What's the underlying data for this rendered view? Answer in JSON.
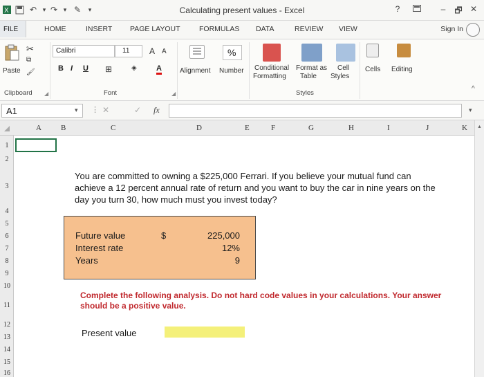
{
  "window": {
    "title": "Calculating present values - Excel",
    "help": "?",
    "minimize": "–",
    "restore": "🗗",
    "close": "✕"
  },
  "quick_access": [
    "save-icon",
    "undo-icon",
    "redo-icon",
    "customize-icon"
  ],
  "tabs": {
    "file": "FILE",
    "items": [
      "HOME",
      "INSERT",
      "PAGE LAYOUT",
      "FORMULAS",
      "DATA",
      "REVIEW",
      "VIEW"
    ],
    "sign_in": "Sign In"
  },
  "ribbon": {
    "clipboard": {
      "paste": "Paste",
      "label": "Clipboard"
    },
    "font": {
      "name": "Calibri",
      "size": "11",
      "grow": "A",
      "shrink": "A",
      "bold": "B",
      "italic": "I",
      "underline": "U",
      "font_color": "A",
      "label": "Font"
    },
    "alignment": "Alignment",
    "number": {
      "symbol": "%",
      "label": "Number"
    },
    "styles": {
      "conditional": "Conditional",
      "conditional2": "Formatting",
      "format_as": "Format as",
      "format_as2": "Table",
      "cell": "Cell",
      "cell2": "Styles",
      "label": "Styles"
    },
    "cells": "Cells",
    "editing": "Editing"
  },
  "formula_bar": {
    "name_box": "A1",
    "fx": "fx",
    "cancel": "✕",
    "enter": "✓",
    "value": ""
  },
  "sheet": {
    "columns": [
      "A",
      "B",
      "C",
      "D",
      "E",
      "F",
      "G",
      "H",
      "I",
      "J",
      "K"
    ],
    "rows": [
      "1",
      "2",
      "3",
      "4",
      "5",
      "6",
      "7",
      "8",
      "9",
      "10",
      "11",
      "12",
      "13",
      "14",
      "15",
      "16"
    ],
    "problem_text": "You are committed to owning a $225,000 Ferrari. If you believe your mutual fund can achieve a 12 percent annual rate of return and you want to buy the car in nine years on the day you turn 30, how much must you invest today?",
    "inputs": [
      {
        "label": "Future value",
        "value": "225,000"
      },
      {
        "label": "Interest rate",
        "value": "12%"
      },
      {
        "label": "Years",
        "value": "9"
      }
    ],
    "currency_symbol": "$",
    "instructions": "Complete the following analysis. Do not hard code values in your calculations. Your answer should be a positive value.",
    "present_value_label": "Present value",
    "present_value": ""
  },
  "colors": {
    "accent": "#217346",
    "input_box": "#f6c08e",
    "answer_cell": "#f4f07a",
    "instruction_text": "#c0282d"
  }
}
